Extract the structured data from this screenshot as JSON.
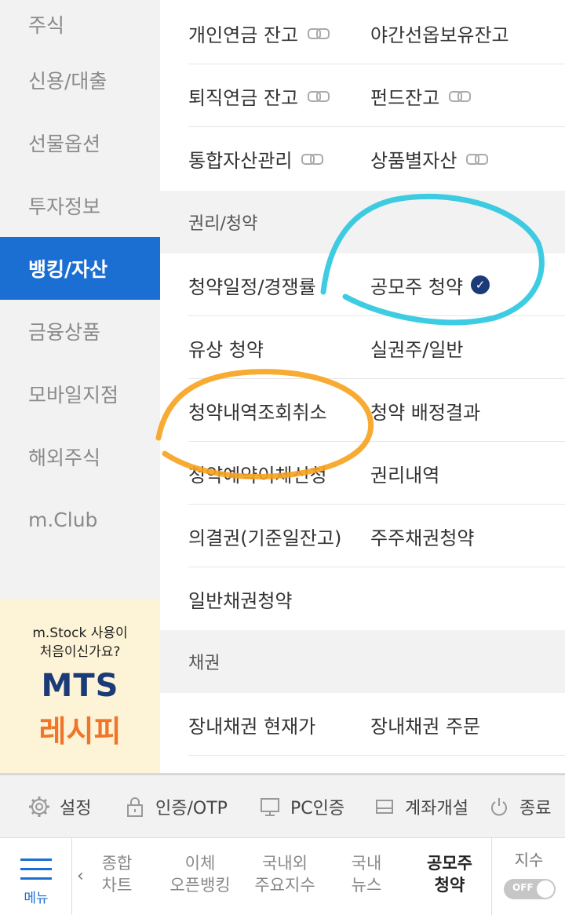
{
  "sidebar": {
    "items": [
      {
        "label": "주식"
      },
      {
        "label": "신용/대출"
      },
      {
        "label": "선물옵션"
      },
      {
        "label": "투자정보"
      },
      {
        "label": "뱅킹/자산"
      },
      {
        "label": "금융상품"
      },
      {
        "label": "모바일지점"
      },
      {
        "label": "해외주식"
      },
      {
        "label": "m.Club"
      }
    ],
    "active_index": 4,
    "promo": {
      "line1": "m.Stock 사용이",
      "line2": "처음이신가요?",
      "title": "MTS",
      "subtitle": "레시피"
    }
  },
  "main": {
    "asset_rows": [
      [
        "개인연금 잔고",
        "야간선옵보유잔고"
      ],
      [
        "퇴직연금 잔고",
        "펀드잔고"
      ],
      [
        "통합자산관리",
        "상품별자산"
      ]
    ],
    "rights_section": {
      "title": "권리/청약",
      "rows": [
        [
          "청약일정/경쟁률",
          "공모주 청약"
        ],
        [
          "유상 청약",
          "실권주/일반"
        ],
        [
          "청약내역조회취소",
          "청약 배정결과"
        ],
        [
          "청약예약이체신청",
          "권리내역"
        ],
        [
          "의결권(기준일잔고)",
          "주주채권청약"
        ],
        [
          "일반채권청약",
          ""
        ]
      ]
    },
    "bond_section": {
      "title": "채권",
      "rows": [
        [
          "장내채권 현재가",
          "장내채권 주문"
        ]
      ]
    }
  },
  "settings_bar": {
    "settings": "설정",
    "auth_otp": "인증/OTP",
    "pc_auth": "PC인증",
    "open_account": "계좌개설",
    "exit": "종료"
  },
  "bottom_nav": {
    "menu_label": "메뉴",
    "items": [
      {
        "line1": "종합",
        "line2": "차트"
      },
      {
        "line1": "이체",
        "line2": "오픈뱅킹"
      },
      {
        "line1": "국내외",
        "line2": "주요지수"
      },
      {
        "line1": "국내",
        "line2": "뉴스"
      },
      {
        "line1": "공모주",
        "line2": "청약"
      }
    ],
    "index_label": "지수",
    "toggle_state": "OFF"
  },
  "colors": {
    "accent": "#1c6fd2",
    "annotation_cyan": "#29c6e0",
    "annotation_orange": "#f7a21c"
  }
}
